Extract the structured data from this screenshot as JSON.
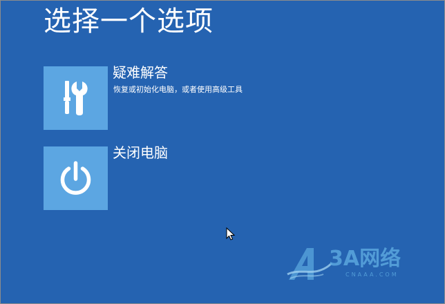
{
  "screen": {
    "title": "选择一个选项",
    "background_color": "#2563b1",
    "tile_color": "#5ca6e2"
  },
  "options": [
    {
      "title": "疑难解答",
      "description": "恢复或初始化电脑，或者使用高级工具",
      "icon": "tools-icon"
    },
    {
      "title": "关闭电脑",
      "description": "",
      "icon": "power-icon"
    }
  ],
  "watermark": {
    "text": "3A网络",
    "sub": "CNAAA.COM"
  }
}
